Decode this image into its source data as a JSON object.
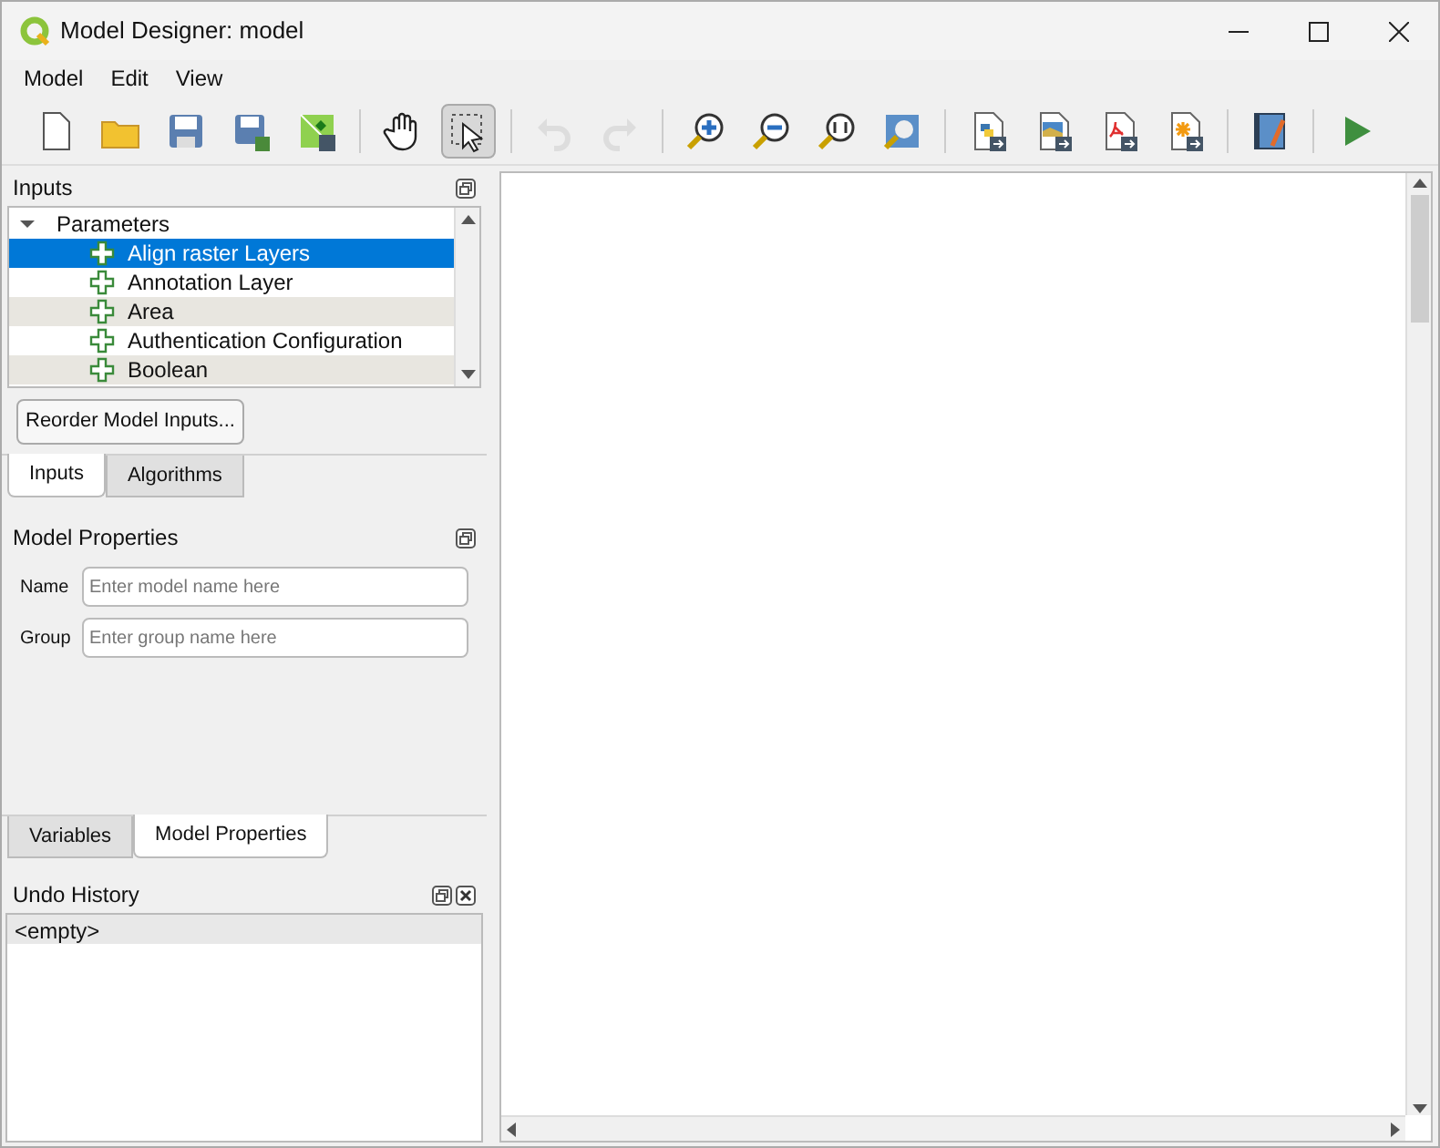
{
  "window": {
    "title": "Model Designer: model"
  },
  "menu": [
    "Model",
    "Edit",
    "View"
  ],
  "toolbar": [
    {
      "kind": "new",
      "selected": false,
      "disabled": false
    },
    {
      "kind": "open",
      "selected": false,
      "disabled": false
    },
    {
      "kind": "save",
      "selected": false,
      "disabled": false
    },
    {
      "kind": "saveas",
      "selected": false,
      "disabled": false
    },
    {
      "kind": "export-project",
      "selected": false,
      "disabled": false
    },
    {
      "kind": "sep"
    },
    {
      "kind": "pan",
      "selected": false,
      "disabled": false
    },
    {
      "kind": "select",
      "selected": true,
      "disabled": false
    },
    {
      "kind": "sep"
    },
    {
      "kind": "undo",
      "selected": false,
      "disabled": true
    },
    {
      "kind": "redo",
      "selected": false,
      "disabled": true
    },
    {
      "kind": "sep"
    },
    {
      "kind": "zoom-in",
      "selected": false,
      "disabled": false
    },
    {
      "kind": "zoom-out",
      "selected": false,
      "disabled": false
    },
    {
      "kind": "zoom-actual",
      "selected": false,
      "disabled": false
    },
    {
      "kind": "zoom-full",
      "selected": false,
      "disabled": false
    },
    {
      "kind": "sep"
    },
    {
      "kind": "export-python",
      "selected": false,
      "disabled": false
    },
    {
      "kind": "export-image",
      "selected": false,
      "disabled": false
    },
    {
      "kind": "export-pdf",
      "selected": false,
      "disabled": false
    },
    {
      "kind": "export-svg",
      "selected": false,
      "disabled": false
    },
    {
      "kind": "sep"
    },
    {
      "kind": "help",
      "selected": false,
      "disabled": false
    },
    {
      "kind": "sep"
    },
    {
      "kind": "run",
      "selected": false,
      "disabled": false
    }
  ],
  "inputs_panel": {
    "title": "Inputs",
    "tree": [
      {
        "label": "Parameters",
        "expanded": true,
        "children": [
          {
            "label": "Align raster Layers",
            "selected": true
          },
          {
            "label": "Annotation Layer",
            "selected": false
          },
          {
            "label": "Area",
            "selected": false
          },
          {
            "label": "Authentication Configuration",
            "selected": false
          },
          {
            "label": "Boolean",
            "selected": false
          }
        ]
      }
    ],
    "reorder_button": "Reorder Model Inputs...",
    "tabs": [
      {
        "label": "Inputs",
        "selected": true
      },
      {
        "label": "Algorithms",
        "selected": false
      }
    ]
  },
  "model_properties": {
    "title": "Model Properties",
    "fields": [
      {
        "label": "Name",
        "placeholder": "Enter model name here"
      },
      {
        "label": "Group",
        "placeholder": "Enter group name here"
      }
    ],
    "tabs": [
      {
        "label": "Variables",
        "selected": false
      },
      {
        "label": "Model Properties",
        "selected": true
      }
    ]
  },
  "undo_history": {
    "title": "Undo History",
    "items": [
      "<empty>"
    ]
  }
}
